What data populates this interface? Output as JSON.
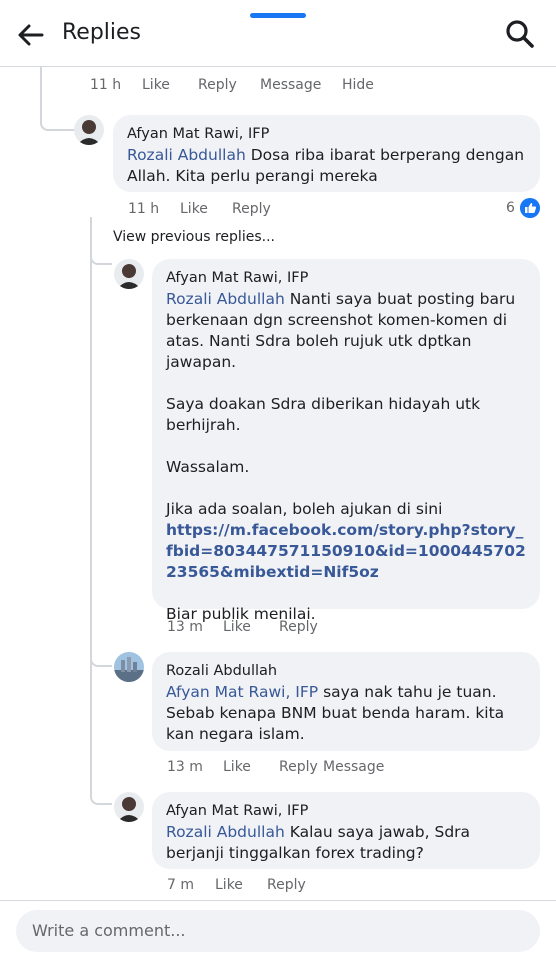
{
  "header": {
    "title": "Replies"
  },
  "colors": {
    "accent": "#1877f2",
    "mention": "#385898",
    "bubble": "#f0f2f5"
  },
  "top_actions": {
    "time": "11 h",
    "like": "Like",
    "reply": "Reply",
    "message": "Message",
    "hide": "Hide"
  },
  "comment1": {
    "author": "Afyan Mat Rawi, IFP",
    "mention": "Rozali Abdullah",
    "text": " Dosa riba ibarat berperang dengan Allah. Kita perlu perangi mereka",
    "time": "11 h",
    "like": "Like",
    "reply": "Reply",
    "reaction_count": "6",
    "reaction_icon": "thumbs-up-icon"
  },
  "view_previous": "View previous replies...",
  "reply1": {
    "author": "Afyan Mat Rawi, IFP",
    "mention": "Rozali Abdullah",
    "p1": " Nanti saya buat posting baru berkenaan dgn screenshot komen-komen di atas. Nanti Sdra boleh rujuk utk dptkan jawapan.",
    "p2": "Saya doakan Sdra diberikan hidayah utk berhijrah.",
    "p3": "Wassalam.",
    "p4": "Jika ada soalan, boleh ajukan di sini",
    "link": "https://m.facebook.com/story.php?story_fbid=803447571150910&id=100044570223565&mibextid=Nif5oz",
    "p5": "Biar publik menilai.",
    "time": "13 m",
    "like": "Like",
    "reply": "Reply"
  },
  "reply2": {
    "author": "Rozali Abdullah",
    "mention": "Afyan Mat Rawi, IFP",
    "text": " saya nak tahu je tuan. Sebab kenapa BNM buat benda haram. kita kan negara islam.",
    "time": "13 m",
    "like": "Like",
    "reply": "Reply",
    "message": "Message"
  },
  "reply3": {
    "author": "Afyan Mat Rawi, IFP",
    "mention": "Rozali Abdullah",
    "text": " Kalau saya jawab, Sdra berjanji tinggalkan forex trading?",
    "time": "7 m",
    "like": "Like",
    "reply": "Reply"
  },
  "composer": {
    "placeholder": "Write a comment..."
  }
}
